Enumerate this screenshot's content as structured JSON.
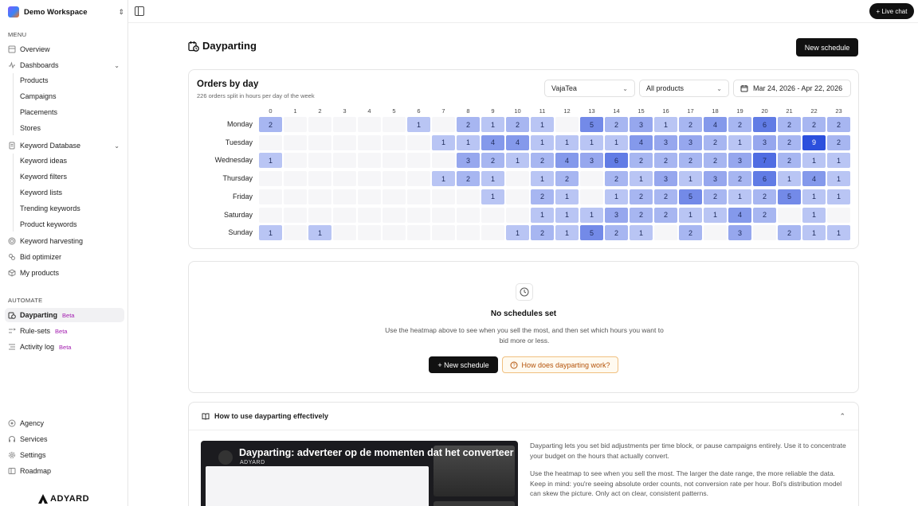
{
  "workspace": {
    "name": "Demo Workspace"
  },
  "topbar": {
    "live_chat": "+ Live chat"
  },
  "sidebar": {
    "menu_label": "MENU",
    "overview": "Overview",
    "dashboards": "Dashboards",
    "dashboards_items": [
      "Products",
      "Campaigns",
      "Placements",
      "Stores"
    ],
    "keyword_database": "Keyword Database",
    "keyword_items": [
      "Keyword ideas",
      "Keyword filters",
      "Keyword lists",
      "Trending keywords",
      "Product keywords"
    ],
    "keyword_harvesting": "Keyword harvesting",
    "bid_optimizer": "Bid optimizer",
    "my_products": "My products",
    "automate_label": "AUTOMATE",
    "dayparting": "Dayparting",
    "rule_sets": "Rule-sets",
    "activity_log": "Activity log",
    "beta": "Beta",
    "agency": "Agency",
    "services": "Services",
    "settings": "Settings",
    "roadmap": "Roadmap",
    "brand": "ADYARD"
  },
  "page": {
    "title": "Dayparting",
    "new_schedule": "New schedule"
  },
  "orders_card": {
    "title": "Orders by day",
    "subtitle": "226 orders split in hours per day of the week",
    "store_select": "VajaTea",
    "product_select": "All products",
    "date_range": "Mar 24, 2026 - Apr 22, 2026"
  },
  "heatmap": {
    "hours": [
      "0",
      "1",
      "2",
      "3",
      "4",
      "5",
      "6",
      "7",
      "8",
      "9",
      "10",
      "11",
      "12",
      "13",
      "14",
      "15",
      "16",
      "17",
      "18",
      "19",
      "20",
      "21",
      "22",
      "23"
    ],
    "days": [
      "Monday",
      "Tuesday",
      "Wednesday",
      "Thursday",
      "Friday",
      "Saturday",
      "Sunday"
    ],
    "values": [
      [
        2,
        0,
        0,
        0,
        0,
        0,
        1,
        0,
        2,
        1,
        2,
        1,
        0,
        5,
        2,
        3,
        1,
        2,
        4,
        2,
        6,
        2,
        2,
        2
      ],
      [
        0,
        0,
        0,
        0,
        0,
        0,
        0,
        1,
        1,
        4,
        4,
        1,
        1,
        1,
        1,
        4,
        3,
        3,
        2,
        1,
        3,
        2,
        9,
        2
      ],
      [
        1,
        0,
        0,
        0,
        0,
        0,
        0,
        0,
        3,
        2,
        1,
        2,
        4,
        3,
        6,
        2,
        2,
        2,
        2,
        3,
        7,
        2,
        1,
        1
      ],
      [
        0,
        0,
        0,
        0,
        0,
        0,
        0,
        1,
        2,
        1,
        0,
        1,
        2,
        0,
        2,
        1,
        3,
        1,
        3,
        2,
        6,
        1,
        4,
        1
      ],
      [
        0,
        0,
        0,
        0,
        0,
        0,
        0,
        0,
        0,
        1,
        0,
        2,
        1,
        0,
        1,
        2,
        2,
        5,
        2,
        1,
        2,
        5,
        1,
        1
      ],
      [
        0,
        0,
        0,
        0,
        0,
        0,
        0,
        0,
        0,
        0,
        0,
        1,
        1,
        1,
        3,
        2,
        2,
        1,
        1,
        4,
        2,
        0,
        1,
        0
      ],
      [
        1,
        0,
        1,
        0,
        0,
        0,
        0,
        0,
        0,
        0,
        1,
        2,
        1,
        5,
        2,
        1,
        0,
        2,
        0,
        3,
        0,
        2,
        1,
        1
      ]
    ],
    "max": 9
  },
  "empty_state": {
    "title": "No schedules set",
    "description": "Use the heatmap above to see when you sell the most, and then set which hours you want to bid more or less.",
    "new_schedule": "+ New schedule",
    "how_it_works": "How does dayparting work?"
  },
  "howto": {
    "title": "How to use dayparting effectively",
    "video_title": "Dayparting: adverteer op de momenten dat het converteer",
    "video_brand": "ADYARD",
    "paragraph1": "Dayparting lets you set bid adjustments per time block, or pause campaigns entirely. Use it to concentrate your budget on the hours that actually convert.",
    "paragraph2": "Use the heatmap to see when you sell the most. The larger the date range, the more reliable the data. Keep in mind: you're seeing absolute order counts, not conversion rate per hour. Bol's distribution model can skew the picture. Only act on clear, consistent patterns."
  }
}
